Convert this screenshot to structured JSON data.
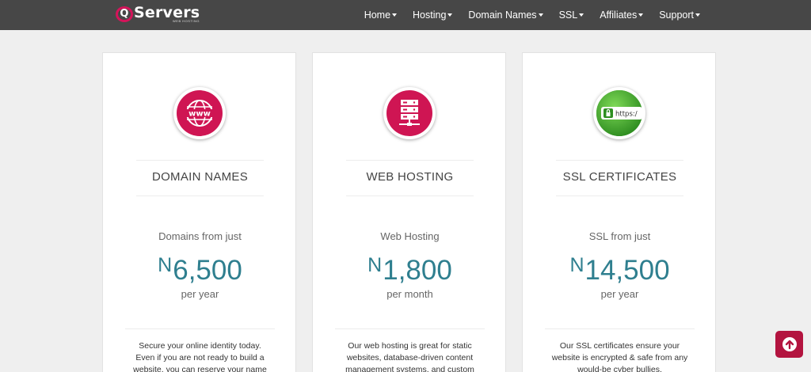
{
  "brand": {
    "name": "Servers",
    "tagline": "WEB HOSTING",
    "q_letter": "Q"
  },
  "nav": [
    {
      "label": "Home"
    },
    {
      "label": "Hosting"
    },
    {
      "label": "Domain Names"
    },
    {
      "label": "SSL"
    },
    {
      "label": "Affiliates"
    },
    {
      "label": "Support"
    }
  ],
  "cards": [
    {
      "title": "DOMAIN NAMES",
      "price_label": "Domains from just",
      "currency": "N",
      "price": "6,500",
      "period": "per year",
      "description": "Secure your online identity today. Even if you are not ready to build a website, you can reserve your name",
      "icon": "www-globe-icon"
    },
    {
      "title": "WEB HOSTING",
      "price_label": "Web Hosting",
      "currency": "N",
      "price": "1,800",
      "period": "per month",
      "description": "Our web hosting is great for static websites, database-driven content management systems, and custom",
      "icon": "server-icon"
    },
    {
      "title": "SSL CERTIFICATES",
      "price_label": "SSL from just",
      "currency": "N",
      "price": "14,500",
      "period": "per year",
      "description": "Our SSL certificates ensure your website is encrypted & safe from any would-be cyber bullies.",
      "icon": "ssl-lock-icon",
      "icon_text": "https:/"
    }
  ],
  "colors": {
    "navbar": "#474747",
    "accent": "#cf1553",
    "price": "#2f7f8f",
    "ssl_green": "#3a9e2c",
    "back_to_top": "#b3143f"
  }
}
